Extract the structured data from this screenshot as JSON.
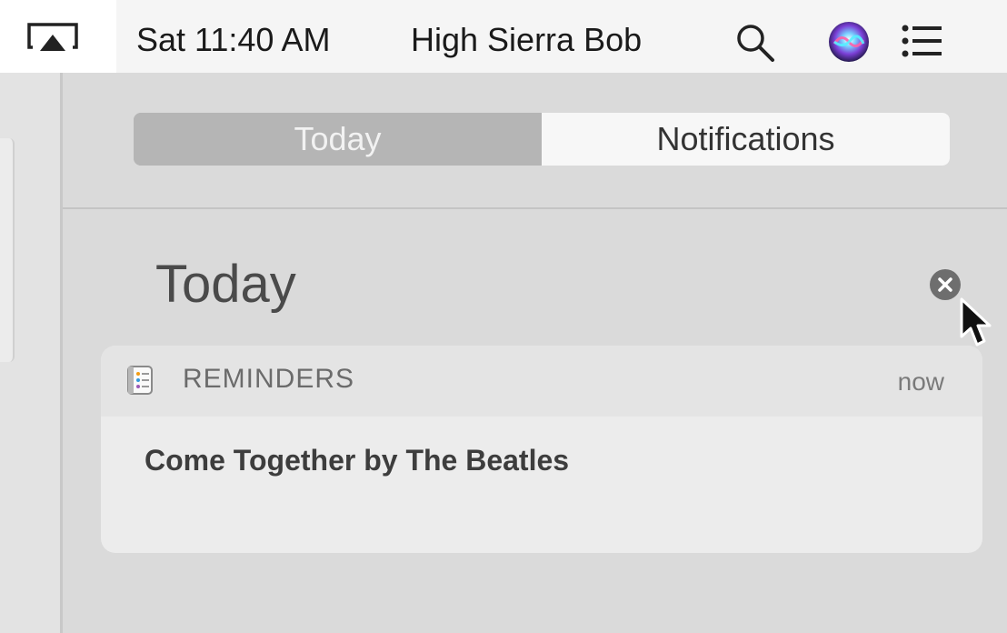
{
  "menubar": {
    "clock": "Sat 11:40 AM",
    "user": "High Sierra Bob",
    "icons": [
      "airplay-icon",
      "search-icon",
      "siri-icon",
      "notification-center-icon"
    ]
  },
  "notification_center": {
    "tabs": [
      {
        "label": "Today",
        "selected": true
      },
      {
        "label": "Notifications",
        "selected": false
      }
    ],
    "section_title": "Today",
    "notification": {
      "app_icon": "reminders-icon",
      "app_name": "REMINDERS",
      "time": "now",
      "message": "Come Together by The Beatles"
    }
  },
  "colors": {
    "panel_bg": "#dadada",
    "selected_segment": "#b5b5b5",
    "card_bg": "#ececec"
  }
}
